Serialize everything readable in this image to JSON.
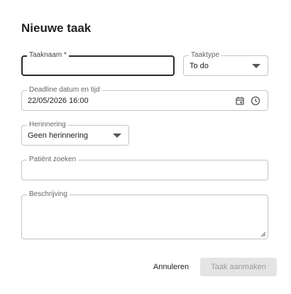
{
  "dialog": {
    "title": "Nieuwe taak"
  },
  "fields": {
    "task_name": {
      "label": "Taaknaam *",
      "value": ""
    },
    "task_type": {
      "label": "Taaktype",
      "value": "To do"
    },
    "deadline": {
      "label": "Deadline datum en tijd",
      "value": "22/05/2026 16:00"
    },
    "reminder": {
      "label": "Herinnering",
      "value": "Geen herinnering"
    },
    "patient": {
      "label": "Patiënt zoeken",
      "value": ""
    },
    "description": {
      "label": "Beschrijving",
      "value": ""
    }
  },
  "actions": {
    "cancel_label": "Annuleren",
    "create_label": "Taak aanmaken"
  },
  "icons": {
    "calendar": "calendar-icon",
    "clock": "clock-icon",
    "dropdown": "chevron-down-icon",
    "resize": "resize-handle-icon"
  },
  "colors": {
    "focused_border": "#2b2b2b",
    "border": "#c4c4c4",
    "disabled_bg": "#e4e4e4",
    "disabled_text": "#9a9a9a"
  }
}
